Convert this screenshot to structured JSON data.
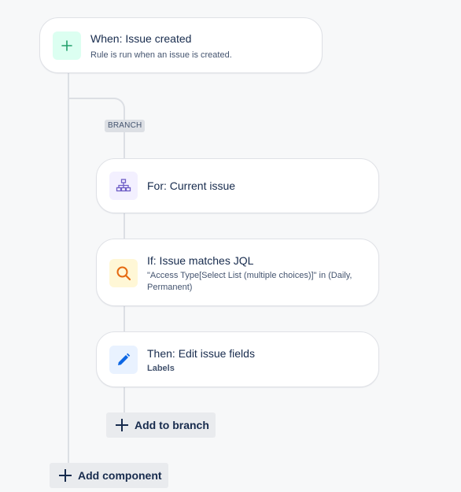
{
  "trigger": {
    "title": "When: Issue created",
    "description": "Rule is run when an issue is created.",
    "icon": "plus-icon",
    "icon_color": "#22a06b",
    "icon_bg": "#dcfff1"
  },
  "branch": {
    "badge": "BRANCH",
    "components": [
      {
        "title": "For: Current issue",
        "icon": "hierarchy-icon",
        "icon_color": "#6e5dc6",
        "icon_bg": "#f3f0ff"
      },
      {
        "title": "If: Issue matches JQL",
        "description": "\"Access Type[Select List (multiple choices)]\" in (Daily, Permanent)",
        "icon": "search-icon",
        "icon_color": "#e56910",
        "icon_bg": "#fff7d6"
      },
      {
        "title": "Then: Edit issue fields",
        "description": "Labels",
        "icon": "pencil-icon",
        "icon_color": "#0c66e4",
        "icon_bg": "#e9f2ff"
      }
    ],
    "add_button": "Add to branch"
  },
  "add_component_button": "Add component"
}
